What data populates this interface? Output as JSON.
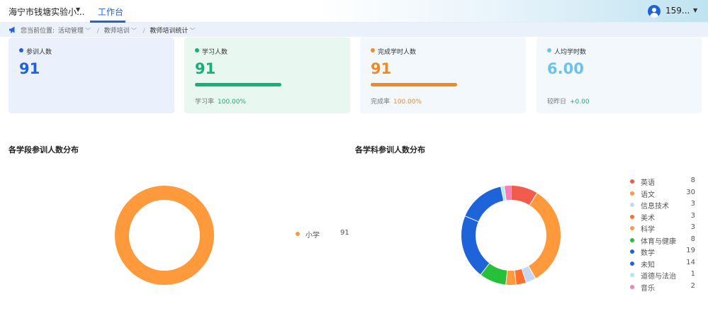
{
  "header": {
    "school_name": "海宁市钱塘实验小...",
    "tab_label": "工作台",
    "user_name": "159..."
  },
  "breadcrumb": {
    "prefix": "您当前位置:",
    "items": [
      "活动管理",
      "教师培训",
      "教师培训统计"
    ]
  },
  "stats": [
    {
      "label": "参训人数",
      "value": "91",
      "color": "#1e63d9"
    },
    {
      "label": "学习人数",
      "value": "91",
      "color": "#16b07a",
      "sub_label": "学习率",
      "sub_value": "100.00%",
      "progress": 1.0
    },
    {
      "label": "完成学时人数",
      "value": "91",
      "color": "#f08a24",
      "sub_label": "完成率",
      "sub_value": "100.00%",
      "progress": 1.0
    },
    {
      "label": "人均学时数",
      "value": "6.00",
      "color": "#6cc3e8",
      "sub_label": "较昨日",
      "sub_value": "+0.00",
      "sub_color": "#16b07a"
    }
  ],
  "sections": {
    "stage_title": "各学段参训人数分布",
    "subject_title": "各学科参训人数分布"
  },
  "chart_data": [
    {
      "type": "pie",
      "donut": true,
      "title": "各学段参训人数分布",
      "categories": [
        "小学"
      ],
      "values": [
        91
      ],
      "colors": [
        "#ff9a3c"
      ],
      "legend": "right"
    },
    {
      "type": "pie",
      "donut": true,
      "title": "各学科参训人数分布",
      "categories": [
        "英语",
        "语文",
        "信息技术",
        "美术",
        "科学",
        "体育与健康",
        "数学",
        "未知",
        "道德与法治",
        "音乐"
      ],
      "values": [
        8,
        30,
        3,
        3,
        3,
        8,
        19,
        14,
        1,
        2
      ],
      "colors": [
        "#f25c4d",
        "#ff9a3c",
        "#c8d7f0",
        "#ff6f2d",
        "#ff9a3c",
        "#26c03a",
        "#1e63d9",
        "#1e63d9",
        "#a8ecf6",
        "#f77fb5"
      ],
      "legend": "right"
    }
  ]
}
